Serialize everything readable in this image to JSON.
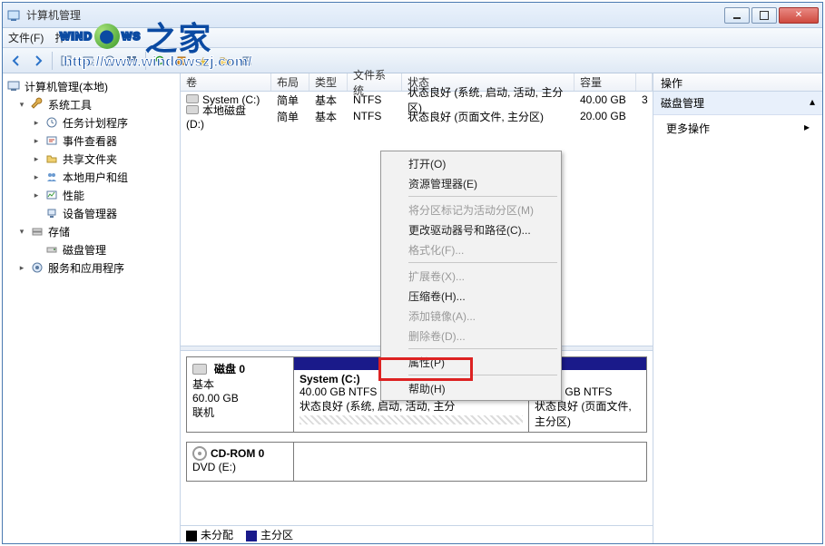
{
  "window": {
    "title": "计算机管理"
  },
  "menubar": {
    "file": "文件(F)",
    "extra": "拃"
  },
  "tree": {
    "root": "计算机管理(本地)",
    "system_tools": "系统工具",
    "task_scheduler": "任务计划程序",
    "event_viewer": "事件查看器",
    "shared_folders": "共享文件夹",
    "local_users": "本地用户和组",
    "performance": "性能",
    "device_manager": "设备管理器",
    "storage": "存储",
    "disk_management": "磁盘管理",
    "services_apps": "服务和应用程序"
  },
  "vol_header": {
    "vol": "卷",
    "layout": "布局",
    "type": "类型",
    "fs": "文件系统",
    "status": "状态",
    "capacity": "容量"
  },
  "volumes": [
    {
      "name": "System (C:)",
      "layout": "简单",
      "type": "基本",
      "fs": "NTFS",
      "status": "状态良好 (系统, 启动, 活动, 主分区)",
      "capacity": "40.00 GB",
      "free": "3"
    },
    {
      "name": "本地磁盘 (D:)",
      "layout": "简单",
      "type": "基本",
      "fs": "NTFS",
      "status": "状态良好 (页面文件, 主分区)",
      "capacity": "20.00 GB",
      "free": ""
    }
  ],
  "disk0": {
    "label": "磁盘 0",
    "type": "基本",
    "size": "60.00 GB",
    "state": "联机",
    "p1_name": "System  (C:)",
    "p1_size": "40.00 GB NTFS",
    "p1_status": "状态良好 (系统, 启动, 活动, 主分",
    "p2_size": "20.00 GB NTFS",
    "p2_status": "状态良好 (页面文件, 主分区)"
  },
  "cdrom": {
    "label": "CD-ROM 0",
    "sub": "DVD (E:)"
  },
  "legend": {
    "unalloc": "未分配",
    "primary": "主分区"
  },
  "actions": {
    "header": "操作",
    "section": "磁盘管理",
    "more": "更多操作"
  },
  "ctx": {
    "open": "打开(O)",
    "explorer": "资源管理器(E)",
    "mark_active": "将分区标记为活动分区(M)",
    "change_letter": "更改驱动器号和路径(C)...",
    "format": "格式化(F)...",
    "extend": "扩展卷(X)...",
    "shrink": "压缩卷(H)...",
    "add_mirror": "添加镜像(A)...",
    "delete": "删除卷(D)...",
    "properties": "属性(P)",
    "help": "帮助(H)"
  },
  "watermark": {
    "brand_pre": "WIND",
    "brand_post": "WS",
    "cn": "之家",
    "url": "http://www.windowszj.com/"
  }
}
